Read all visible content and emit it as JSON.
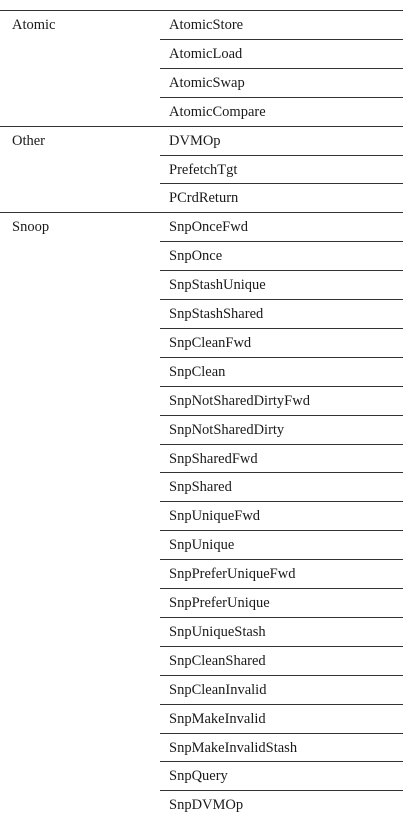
{
  "groups": [
    {
      "category": "Atomic",
      "items": [
        "AtomicStore",
        "AtomicLoad",
        "AtomicSwap",
        "AtomicCompare"
      ]
    },
    {
      "category": "Other",
      "items": [
        "DVMOp",
        "PrefetchTgt",
        "PCrdReturn"
      ]
    },
    {
      "category": "Snoop",
      "items": [
        "SnpOnceFwd",
        "SnpOnce",
        "SnpStashUnique",
        "SnpStashShared",
        "SnpCleanFwd",
        "SnpClean",
        "SnpNotSharedDirtyFwd",
        "SnpNotSharedDirty",
        "SnpSharedFwd",
        "SnpShared",
        "SnpUniqueFwd",
        "SnpUnique",
        "SnpPreferUniqueFwd",
        "SnpPreferUnique",
        "SnpUniqueStash",
        "SnpCleanShared",
        "SnpCleanInvalid",
        "SnpMakeInvalid",
        "SnpMakeInvalidStash",
        "SnpQuery",
        "SnpDVMOp"
      ]
    }
  ]
}
